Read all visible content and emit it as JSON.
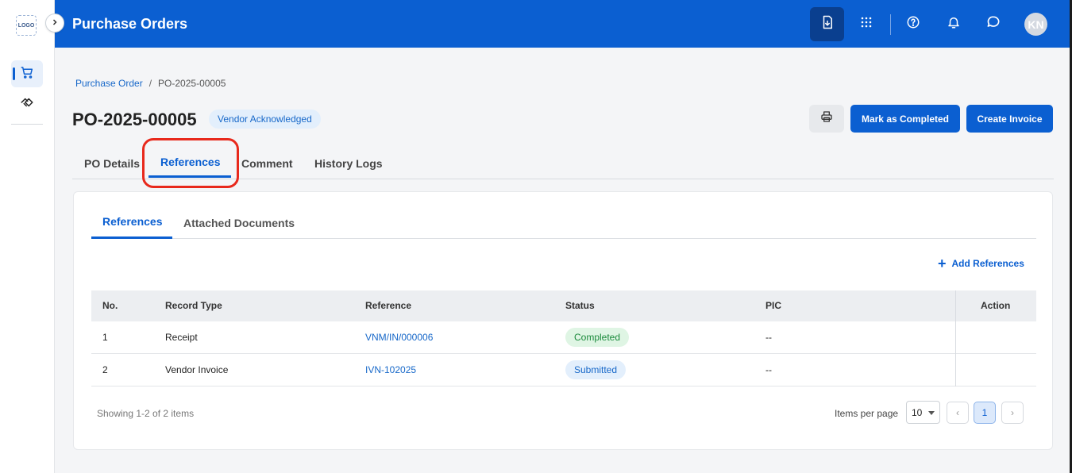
{
  "app": {
    "logo_text": "LOGO",
    "title": "Purchase Orders"
  },
  "rail": {
    "items": [
      {
        "icon": "cart-icon",
        "active": true
      },
      {
        "icon": "handshake-icon",
        "active": false
      }
    ]
  },
  "topbar": {
    "icons": [
      "download-icon",
      "apps-grid-icon",
      "help-icon",
      "bell-icon",
      "chat-icon"
    ],
    "avatar_initials": "KN"
  },
  "breadcrumb": {
    "parent": "Purchase Order",
    "separator": "/",
    "current": "PO-2025-00005"
  },
  "header": {
    "po_number": "PO-2025-00005",
    "status": "Vendor Acknowledged",
    "mark_completed_label": "Mark as Completed",
    "create_invoice_label": "Create Invoice"
  },
  "tabs": {
    "po_details": "PO Details",
    "references": "References",
    "comment": "Comment",
    "history_logs": "History Logs"
  },
  "sub_tabs": {
    "references": "References",
    "attached_documents": "Attached Documents"
  },
  "add_references_label": "Add References",
  "table": {
    "headers": {
      "no": "No.",
      "record_type": "Record Type",
      "reference": "Reference",
      "status": "Status",
      "pic": "PIC",
      "action": "Action"
    },
    "rows": [
      {
        "no": "1",
        "record_type": "Receipt",
        "reference": "VNM/IN/000006",
        "status": "Completed",
        "pic": "--"
      },
      {
        "no": "2",
        "record_type": "Vendor Invoice",
        "reference": "IVN-102025",
        "status": "Submitted",
        "pic": "--"
      }
    ]
  },
  "pagination": {
    "showing_text": "Showing 1-2 of 2 items",
    "items_per_page_label": "Items per page",
    "page_size": "10",
    "prev": "‹",
    "current_page": "1",
    "next": "›"
  },
  "colors": {
    "primary": "#0b5fd1",
    "highlight_ring": "#e8291c",
    "completed": "#1a8a3b"
  }
}
